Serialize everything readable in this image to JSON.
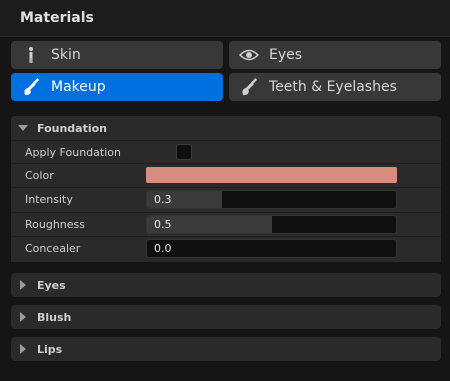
{
  "header": {
    "title": "Materials"
  },
  "tabs": [
    {
      "label": "Skin",
      "icon": "person-icon",
      "active": false
    },
    {
      "label": "Eyes",
      "icon": "eye-icon",
      "active": false
    },
    {
      "label": "Makeup",
      "icon": "brush-icon",
      "active": true
    },
    {
      "label": "Teeth & Eyelashes",
      "icon": "brush-icon",
      "active": false
    }
  ],
  "foundation": {
    "title": "Foundation",
    "expanded": true,
    "apply_label": "Apply Foundation",
    "apply_checked": false,
    "color_label": "Color",
    "color_value": "#d98d7e",
    "intensity_label": "Intensity",
    "intensity_value": "0.3",
    "intensity_fraction": 0.3,
    "roughness_label": "Roughness",
    "roughness_value": "0.5",
    "roughness_fraction": 0.5,
    "concealer_label": "Concealer",
    "concealer_value": "0.0"
  },
  "sections": [
    {
      "title": "Eyes",
      "expanded": false
    },
    {
      "title": "Blush",
      "expanded": false
    },
    {
      "title": "Lips",
      "expanded": false
    }
  ],
  "colors": {
    "accent": "#0070e0",
    "tab_bg": "#383838",
    "panel_bg": "#2a2a2a"
  }
}
